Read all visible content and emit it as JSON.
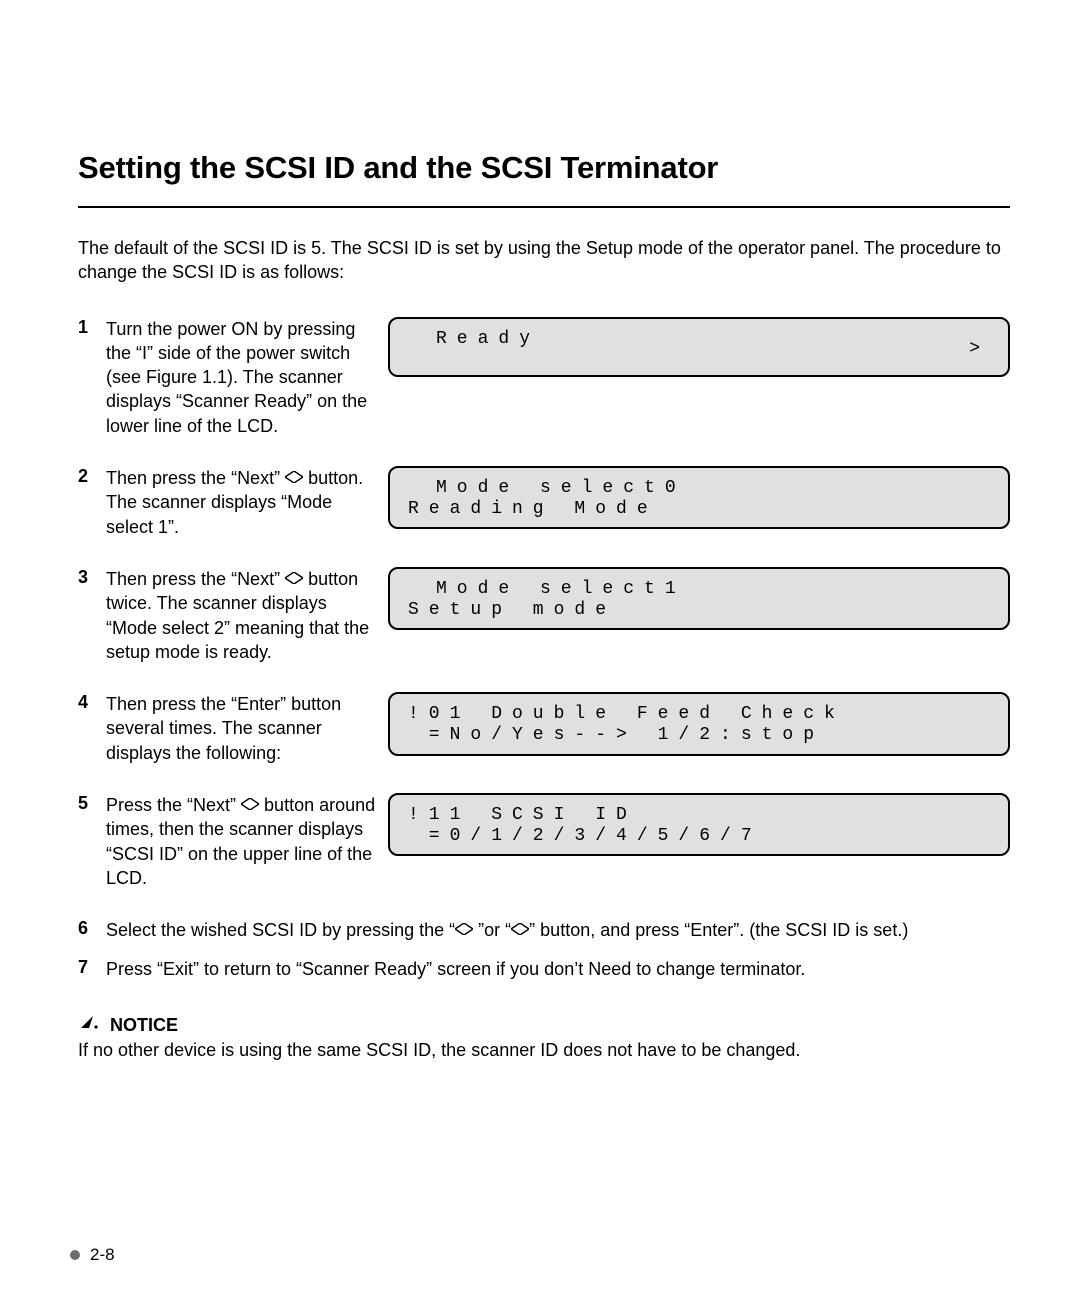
{
  "title": "Setting the SCSI ID and the SCSI Terminator",
  "intro": "The default of the SCSI ID is 5. The SCSI ID is set by using the Setup mode of the operator panel. The procedure to change the SCSI ID is as follows:",
  "steps": [
    {
      "num": "1",
      "text_a": "Turn the power ON by pressing the “I” side of the power switch (see Figure 1.1). The scanner displays “Scanner Ready” on the lower line of the LCD.",
      "lcd": [
        "Ready"
      ],
      "indent_first": true,
      "chevron": ">"
    },
    {
      "num": "2",
      "text_a": "Then press the “Next” ",
      "diamond_after_a": true,
      "text_b": " button. The scanner displays “Mode select 1”.",
      "lcd": [
        "Mode select0",
        "Reading Mode"
      ],
      "indent_first": true
    },
    {
      "num": "3",
      "text_a": "Then press the “Next” ",
      "diamond_after_a": true,
      "text_b": " button twice. The scanner displays “Mode select 2” meaning that the setup mode is ready.",
      "lcd": [
        "Mode select1",
        "Setup mode"
      ],
      "indent_first": true
    },
    {
      "num": "4",
      "text_a": "Then press the “Enter” button several times. The scanner displays the following:",
      "lcd": [
        "!01 Double Feed Check",
        " =No/Yes--> 1/2:stop"
      ]
    },
    {
      "num": "5",
      "text_a": "Press the “Next” ",
      "diamond_after_a": true,
      "text_b": " button around times, then the scanner displays “SCSI ID” on the upper line of the LCD.",
      "lcd": [
        "!11 SCSI ID",
        " =0/1/2/3/4/5/6/7"
      ]
    },
    {
      "num": "6",
      "full_a": "Select the wished SCSI ID by pressing the “",
      "full_diamond1": true,
      "full_mid": " ”or “",
      "full_diamond2": true,
      "full_b": "” button, and press “Enter”. (the SCSI ID is set.)"
    },
    {
      "num": "7",
      "full_a": "Press “Exit” to return to “Scanner Ready” screen if you don’t Need to change terminator."
    }
  ],
  "notice_label": "NOTICE",
  "notice_text": "If no other device is using the same SCSI ID, the scanner ID does not have to be changed.",
  "page_number": "2-8"
}
